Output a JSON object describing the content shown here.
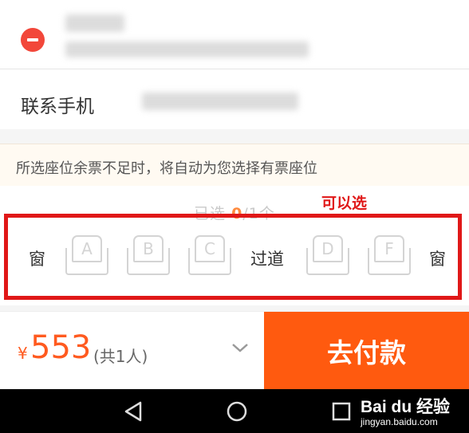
{
  "passenger": {
    "phone_label": "联系手机"
  },
  "notice": {
    "text": "所选座位余票不足时，将自动为您选择有票座位"
  },
  "seat_selection": {
    "selected_prefix": "已选 ",
    "selected_count": "0",
    "selected_suffix": "/1个",
    "annotation": "可以选",
    "window_label": "窗",
    "aisle_label": "过道",
    "seats": [
      "A",
      "B",
      "C",
      "D",
      "F"
    ]
  },
  "footer": {
    "currency": "¥",
    "price": "553",
    "people": "(共1人)",
    "pay_label": "去付款"
  },
  "watermark": {
    "title": "Bai du 经验",
    "sub": "jingyan.baidu.com"
  },
  "colors": {
    "accent": "#ff5a0f",
    "annotation": "#e01818"
  }
}
